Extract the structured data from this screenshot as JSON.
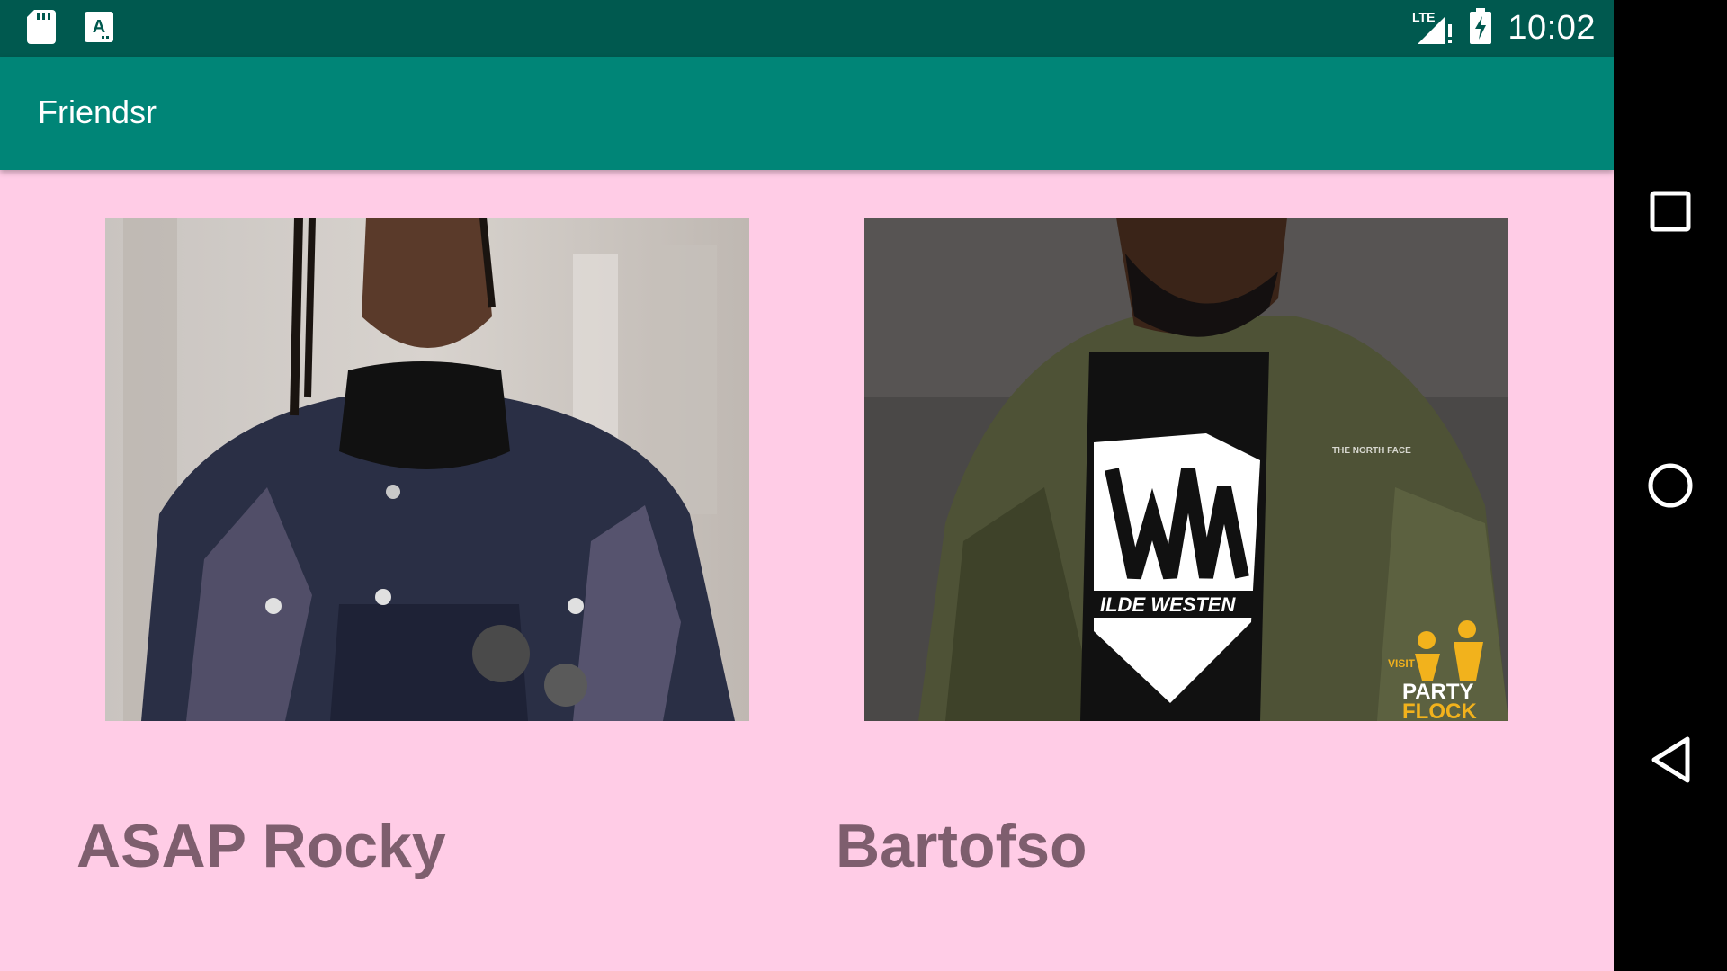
{
  "status_bar": {
    "time": "10:02",
    "network_label": "LTE",
    "icons": [
      "sd-card-icon",
      "keyboard-a-icon",
      "signal-icon",
      "battery-charging-icon"
    ]
  },
  "app_bar": {
    "title": "Friendsr",
    "color": "#008577"
  },
  "friends": [
    {
      "name": "ASAP Rocky",
      "photo": "asap-rocky-photo"
    },
    {
      "name": "Bartofso",
      "photo": "bartofso-photo"
    }
  ],
  "photo_overlays": {
    "bartofso_shirt_text": "ILDE WESTEN",
    "bartofso_jacket_logo": "THE NORTH FACE",
    "watermark_visit": "VISIT",
    "watermark_line1": "PARTY",
    "watermark_line2": "FLOCK"
  },
  "nav_bar": {
    "buttons": [
      "recents-button",
      "home-button",
      "back-button"
    ]
  },
  "colors": {
    "background": "#FFCCE6",
    "status_bar": "#00594F",
    "name_text": "#7E5E6E"
  }
}
